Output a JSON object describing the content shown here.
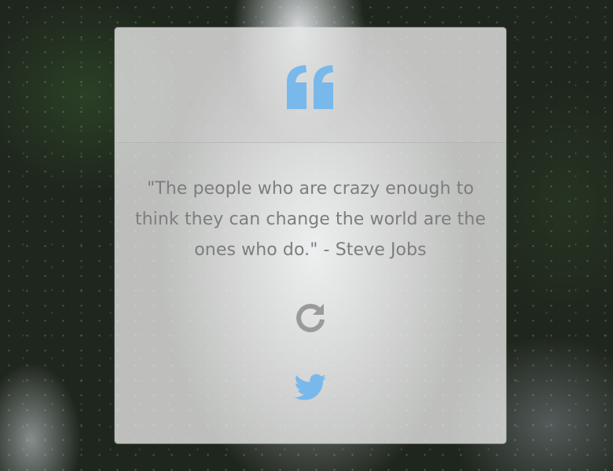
{
  "quote": {
    "text": "\"The people who are crazy enough to think they can change the world are the ones who do.\" - Steve Jobs"
  },
  "icons": {
    "quote_mark": "quote-left-icon",
    "refresh": "refresh-icon",
    "share": "twitter-icon"
  },
  "colors": {
    "accent_blue": "#79b8ea",
    "refresh_gray": "#9a9a9c",
    "quote_text": "#7d7d7f"
  }
}
